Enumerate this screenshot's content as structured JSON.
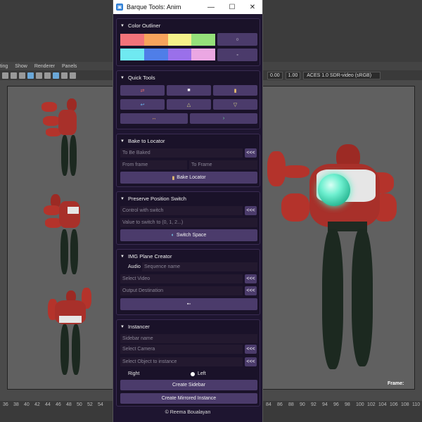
{
  "window": {
    "title": "Barque Tools: Anim",
    "minimize_glyph": "—",
    "maximize_glyph": "☐",
    "close_glyph": "✕"
  },
  "maya": {
    "menu": [
      "ting",
      "Show",
      "Renderer",
      "Panels"
    ],
    "field_a": "0.00",
    "field_b": "1.00",
    "colorspace": "ACES 1.0 SDR-video (sRGB)",
    "frame_label": "Frame:",
    "timeline_ticks": [
      "36",
      "38",
      "40",
      "42",
      "44",
      "46",
      "48",
      "50",
      "52",
      "54",
      "84",
      "86",
      "88",
      "90",
      "92",
      "94",
      "96",
      "98",
      "100",
      "102",
      "104",
      "106",
      "108",
      "110"
    ]
  },
  "color_outliner": {
    "title": "Color Outliner",
    "row1": [
      "#f2737a",
      "#f7a35c",
      "#f5f08a",
      "#95e07a"
    ],
    "row2": [
      "#6fe9f1",
      "#4f7ee8",
      "#9a70ea",
      "#eba7e3"
    ],
    "apply_icon": "○",
    "reset_icon": "◦"
  },
  "quick_tools": {
    "title": "Quick Tools",
    "row1": [
      "⇄",
      "■",
      "▮"
    ],
    "row2": [
      "↩",
      "△",
      "▽"
    ],
    "row3": [
      "↔",
      "›"
    ]
  },
  "bake_to_locator": {
    "title": "Bake to Locator",
    "to_be_baked": "To Be Baked",
    "pick": "<<<",
    "from_frame": "From frame",
    "to_frame": "To Frame",
    "bake_button": "Bake Locator"
  },
  "preserve_position": {
    "title": "Preserve Position Switch",
    "control": "Control with switch",
    "pick": "<<<",
    "value": "Value to switch to (0, 1, 2...)",
    "switch_button": "Switch Space"
  },
  "img_plane": {
    "title": "IMG Plane Creator",
    "audio_label": "Audio",
    "sequence_placeholder": "Sequence name",
    "select_video": "Select Video",
    "output_destination": "Output Destination",
    "pick": "<<<",
    "create_icon": "▪▫"
  },
  "instancer": {
    "title": "Instancer",
    "sidebar_name": "Sidebar name",
    "select_camera": "Select Camera",
    "select_object": "Select Object to instance",
    "pick": "<<<",
    "right": "Right",
    "left": "Left",
    "create_sidebar": "Create Sidebar",
    "create_mirrored": "Create Mirrored Instance"
  },
  "footer": "© Reema Boualayan"
}
